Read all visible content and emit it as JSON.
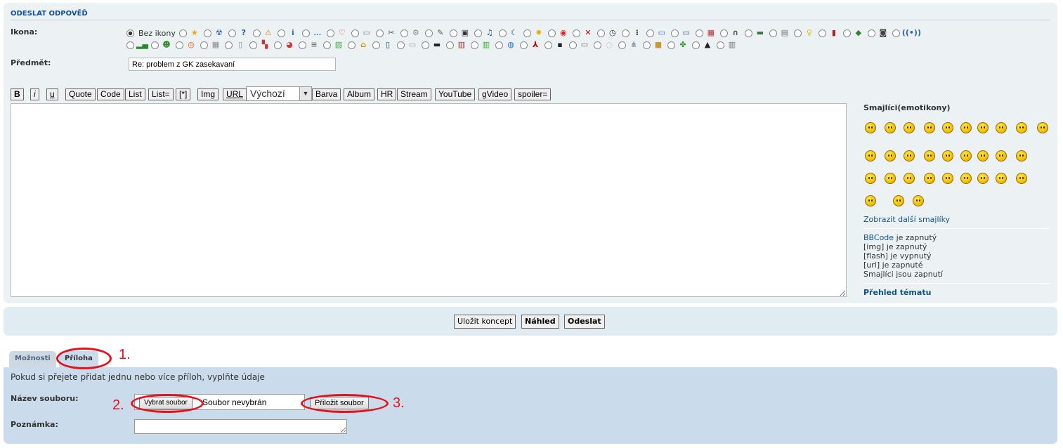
{
  "form": {
    "heading": "Odeslat odpověď",
    "icon_label": "Ikona:",
    "no_icon_label": "Bez ikony",
    "subject_label": "Předmět:",
    "subject_value": "Re: problem z GK zasekavaní"
  },
  "icon_radios_row1": [
    "star",
    "radiation",
    "help",
    "warning",
    "info",
    "speech",
    "heart",
    "windows",
    "tools",
    "gear",
    "satellite",
    "tv",
    "music",
    "moon",
    "burst",
    "lifebuoy",
    "error",
    "clock",
    "traffic-light",
    "monitor",
    "laptop",
    "wall",
    "headset",
    "ram",
    "printer",
    "lightbulb",
    "battery",
    "paint",
    "gamepad",
    "signal"
  ],
  "icon_radios_row2": [
    "signal-bars",
    "grin",
    "lifebuoy-2",
    "calendar",
    "document",
    "blocks",
    "palette",
    "database",
    "picture",
    "padlock",
    "mobile",
    "keyboard",
    "terminal",
    "book",
    "chart",
    "globe",
    "pdf",
    "save",
    "scanner",
    "cd",
    "usb",
    "box",
    "clover",
    "hat",
    "trash"
  ],
  "toolbar": {
    "buttons": [
      "B",
      "i",
      "u",
      "Quote",
      "Code",
      "List",
      "List=",
      "[*]",
      "Img",
      "URL"
    ],
    "font_size_select": "Výchozí",
    "buttons2": [
      "Barva",
      "Album",
      "HR",
      "Stream",
      "YouTube",
      "gVideo",
      "spoiler="
    ]
  },
  "sidebar": {
    "smilies_heading": "Smajlíci(emotikony)",
    "more_smilies": "Zobrazit další smajlíky",
    "bbcode_link": "BBCode",
    "bbcode_status": "je zapnutý",
    "img_status": "[img] je zapnutý",
    "flash_status": "[flash] je vypnutý",
    "url_status": "[url] je zapnuté",
    "smilies_status": "Smajlíci jsou zapnutí",
    "topic_review": "Přehled tématu"
  },
  "actions": {
    "save_draft": "Uložit koncept",
    "preview": "Náhled",
    "submit": "Odeslat"
  },
  "tabs": {
    "options": "Možnosti",
    "attachment": "Příloha"
  },
  "attachment": {
    "intro": "Pokud si přejete přidat jednu nebo více příloh, vyplňte údaje",
    "filename_label": "Název souboru:",
    "choose_file": "Vybrat soubor",
    "no_file": "Soubor nevybrán",
    "attach_button": "Přiložit soubor",
    "comment_label": "Poznámka:"
  },
  "annotations": [
    "1.",
    "2.",
    "3."
  ],
  "colors": {
    "accent": "#115098",
    "panel": "#ecf1f3",
    "attach_panel": "#cadceb",
    "annotation": "#e5121c"
  }
}
